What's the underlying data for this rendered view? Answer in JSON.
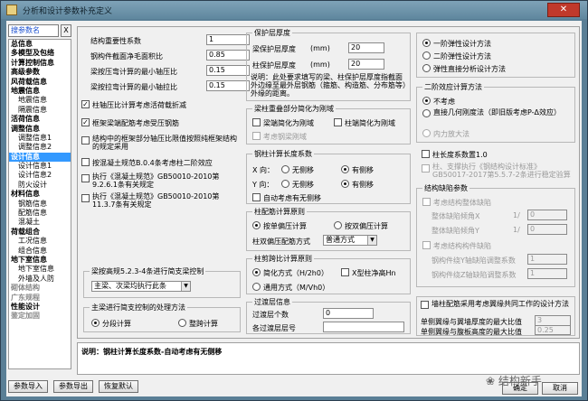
{
  "window": {
    "title": "分析和设计参数补充定义",
    "close": "✕"
  },
  "search": {
    "value": "搜参数名",
    "clear": "X"
  },
  "tree": [
    {
      "label": "总信息",
      "level": 0
    },
    {
      "label": "多模型及包络",
      "level": 0
    },
    {
      "label": "计算控制信息",
      "level": 0
    },
    {
      "label": "高级参数",
      "level": 0
    },
    {
      "label": "风荷载信息",
      "level": 0
    },
    {
      "label": "地震信息",
      "level": 0
    },
    {
      "label": "地震信息",
      "level": 1
    },
    {
      "label": "隔震信息",
      "level": 1
    },
    {
      "label": "活荷信息",
      "level": 0
    },
    {
      "label": "调整信息",
      "level": 0
    },
    {
      "label": "调整信息1",
      "level": 1
    },
    {
      "label": "调整信息2",
      "level": 1
    },
    {
      "label": "设计信息",
      "level": 0,
      "selected": true
    },
    {
      "label": "设计信息1",
      "level": 1
    },
    {
      "label": "设计信息2",
      "level": 1
    },
    {
      "label": "防火设计",
      "level": 1
    },
    {
      "label": "材料信息",
      "level": 0
    },
    {
      "label": "钢筋信息",
      "level": 1
    },
    {
      "label": "配筋信息",
      "level": 1
    },
    {
      "label": "混凝土",
      "level": 1
    },
    {
      "label": "荷载组合",
      "level": 0
    },
    {
      "label": "工况信息",
      "level": 1
    },
    {
      "label": "组合信息",
      "level": 1
    },
    {
      "label": "地下室信息",
      "level": 0
    },
    {
      "label": "地下室信息",
      "level": 1
    },
    {
      "label": "外墙及人防",
      "level": 1
    },
    {
      "label": "砌体结构",
      "level": 0,
      "grey": true
    },
    {
      "label": "广东规程",
      "level": 0,
      "grey": true
    },
    {
      "label": "性能设计",
      "level": 0
    },
    {
      "label": "鉴定加固",
      "level": 0,
      "grey": true
    }
  ],
  "params": [
    {
      "label": "结构重要性系数",
      "value": "1"
    },
    {
      "label": "钢构件截面净毛面积比",
      "value": "0.85"
    },
    {
      "label": "梁按压弯计算的最小轴压比",
      "value": "0.15"
    },
    {
      "label": "梁按拉弯计算的最小轴拉比",
      "value": "0.15"
    }
  ],
  "checks": [
    {
      "label": "柱轴压比计算考虑活荷载折减",
      "checked": true
    },
    {
      "label": "框架梁端配筋考虑受压钢筋",
      "checked": true
    },
    {
      "label": "结构中的框架部分轴压比限值按照纯框架结构的规定采用",
      "checked": false
    },
    {
      "label": "按混凝土规范B.0.4条考虑柱二阶效应",
      "checked": false
    },
    {
      "label": "执行《混凝土规范》GB50010-2010第9.2.6.1条有关规定",
      "checked": false
    },
    {
      "label": "执行《混凝土规范》GB50010-2010第11.3.7条有关规定",
      "checked": false
    }
  ],
  "beam_simple": {
    "title": "梁按高规5.2.3-4条进行简支梁控制",
    "value": "主梁、次梁均执行此条"
  },
  "beam_method": {
    "title": "主梁进行简支控制的处理方法",
    "opt1": "分段计算",
    "opt2": "整跨计算"
  },
  "cover": {
    "title": "保护层厚度",
    "beam_label": "梁保护层厚度",
    "beam_unit": "(mm)",
    "beam_value": "20",
    "col_label": "柱保护层厚度",
    "col_unit": "(mm)",
    "col_value": "20",
    "desc": "说明：此处要求填写的梁、柱保护层厚度指截面外边缘至最外层钢筋（箍筋、构造筋、分布筋等）外缘的距离。"
  },
  "overlap": {
    "title": "梁柱重叠部分简化为刚域",
    "opt1": "梁端简化为刚域",
    "opt2": "柱端简化为刚域",
    "opt3": "考虑钢梁刚域"
  },
  "col_len": {
    "title": "钢柱计算长度系数",
    "x_label": "X 向：",
    "y_label": "Y 向：",
    "nosway": "无侧移",
    "sway": "有侧移",
    "auto": "自动考虑有无侧移"
  },
  "col_rebar": {
    "title": "柱配筋计算原则",
    "opt1": "按单偏压计算",
    "opt2": "按双偏压计算",
    "method_label": "柱双偏压配筋方式",
    "method_value": "普通方式"
  },
  "wall_col": {
    "title": "柱剪跨比计算原则",
    "opt1": "简化方式（H/2h0）",
    "opt2": "通用方式（M/Vh0）",
    "opt3": "X型柱净高Hn"
  },
  "transfer": {
    "title": "过渡层信息",
    "count_label": "过渡层个数",
    "count_value": "0",
    "floor_label": "各过渡层层号",
    "floor_value": ""
  },
  "design_method": {
    "opt1": "一阶弹性设计方法",
    "opt2": "二阶弹性设计方法",
    "opt3": "弹性直接分析设计方法"
  },
  "second_order": {
    "title": "二阶效应计算方法",
    "opt1": "不考虑",
    "opt2": "直接几何刚度法（即旧版考虑P-Δ效应）",
    "opt3": "内力放大法"
  },
  "col_len_factor": {
    "label": "柱长度系数置1.0"
  },
  "steel_col": {
    "label": "柱、支撑执行《钢结构设计标准》GB50017-2017第5.5.7-2条进行稳定验算"
  },
  "defect": {
    "title": "结构缺陷参数",
    "global": "考虑结构整体缺陷",
    "gx": "整体缺陷倾角X",
    "gx_unit": "1/",
    "gx_value": "0",
    "gy": "整体缺陷倾角Y",
    "gy_unit": "1/",
    "gy_value": "0",
    "member": "考虑结构构件缺陷",
    "mx": "钢构件绕Y轴缺陷调整系数",
    "mx_value": "1",
    "my": "钢构件绕Z轴缺陷调整系数",
    "my_value": "1"
  },
  "wall": {
    "label": "墙柱配筋采用考虑翼缘共同工作的设计方法",
    "r1_label": "单侧翼缘与翼墙厚度的最大比值",
    "r1_value": "3",
    "r2_label": "单侧翼缘与腹板高度的最大比值",
    "r2_value": "0.25"
  },
  "note": "说明：钢柱计算长度系数-自动考虑有无侧移",
  "buttons": {
    "import": "参数导入",
    "export": "参数导出",
    "reset": "恢复默认",
    "ok": "确定",
    "cancel": "取消"
  },
  "watermark": "结构新手"
}
